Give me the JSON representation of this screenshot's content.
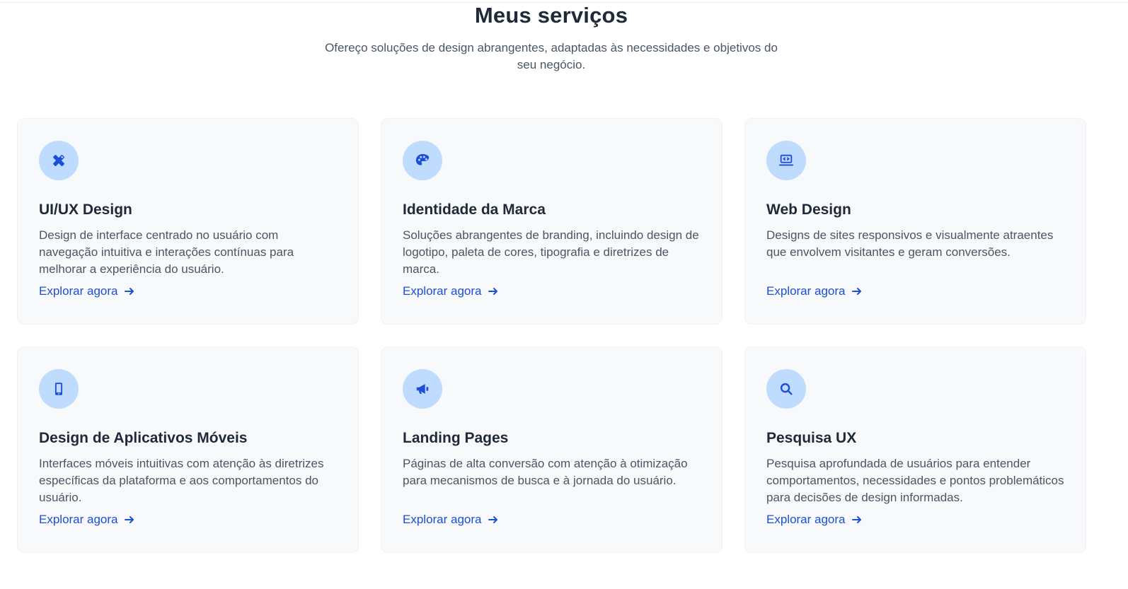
{
  "section": {
    "title": "Meus serviços",
    "subtitle": "Ofereço soluções de design abrangentes, adaptadas às necessidades e objetivos do seu negócio."
  },
  "colors": {
    "accent": "#1d4ed8",
    "icon_bg": "#bfdbfe",
    "card_bg": "#f8f9fb",
    "heading": "#1f2937",
    "body": "#4b5563"
  },
  "services": [
    {
      "icon": "pen-ruler-icon",
      "title": "UI/UX Design",
      "description": "Design de interface centrado no usuário com navegação intuitiva e interações contínuas para melhorar a experiência do usuário.",
      "link": "Explorar agora"
    },
    {
      "icon": "palette-icon",
      "title": "Identidade da Marca",
      "description": "Soluções abrangentes de branding, incluindo design de logotipo, paleta de cores, tipografia e diretrizes de marca.",
      "link": "Explorar agora"
    },
    {
      "icon": "laptop-code-icon",
      "title": "Web Design",
      "description": "Designs de sites responsivos e visualmente atraentes que envolvem visitantes e geram conversões.",
      "link": "Explorar agora"
    },
    {
      "icon": "mobile-icon",
      "title": "Design de Aplicativos Móveis",
      "description": "Interfaces móveis intuitivas com atenção às diretrizes específicas da plataforma e aos comportamentos do usuário.",
      "link": "Explorar agora"
    },
    {
      "icon": "megaphone-icon",
      "title": "Landing Pages",
      "description": "Páginas de alta conversão com atenção à otimização para mecanismos de busca e à jornada do usuário.",
      "link": "Explorar agora"
    },
    {
      "icon": "search-icon",
      "title": "Pesquisa UX",
      "description": "Pesquisa aprofundada de usuários para entender comportamentos, necessidades e pontos problemáticos para decisões de design informadas.",
      "link": "Explorar agora"
    }
  ]
}
